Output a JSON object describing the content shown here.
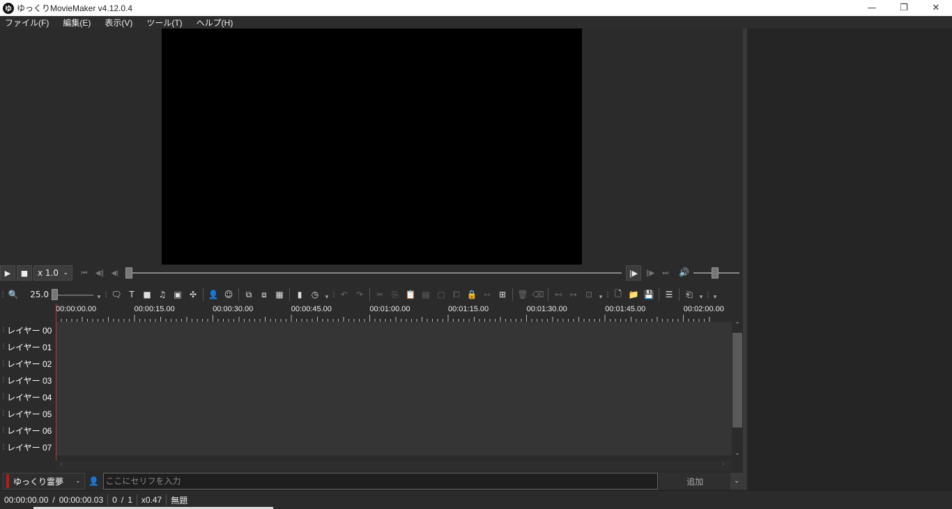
{
  "window": {
    "logo_text": "ゆ",
    "title": "ゆっくりMovieMaker v4.12.0.4",
    "controls": [
      "—",
      "❐",
      "✕"
    ]
  },
  "menu": [
    "ファイル(F)",
    "編集(E)",
    "表示(V)",
    "ツール(T)",
    "ヘルプ(H)"
  ],
  "playback": {
    "speed": "x 1.0",
    "seek_position": 0,
    "volume_level": 0.5
  },
  "toolbar": {
    "zoom_value": "25.0"
  },
  "timeline": {
    "ruler_labels": [
      "00:00:00.00",
      "00:00:15.00",
      "00:00:30.00",
      "00:00:45.00",
      "00:01:00.00",
      "00:01:15.00",
      "00:01:30.00",
      "00:01:45.00",
      "00:02:00.00"
    ],
    "layers": [
      "レイヤー 00",
      "レイヤー 01",
      "レイヤー 02",
      "レイヤー 03",
      "レイヤー 04",
      "レイヤー 05",
      "レイヤー 06",
      "レイヤー 07"
    ]
  },
  "input": {
    "character": "ゆっくり霊夢",
    "character_color": "#b71c1c",
    "placeholder": "ここにセリフを入力",
    "value": "",
    "add_label": "追加"
  },
  "status": {
    "current_time": "00:00:00.00",
    "time_separator": "/",
    "total_time": "00:00:00.03",
    "frame_current": "0",
    "frame_separator": "/",
    "frame_total": "1",
    "zoom": "x0.47",
    "project_name": "無題"
  },
  "colors": {
    "background": "#2b2b2b",
    "playhead": "#c0392b"
  }
}
